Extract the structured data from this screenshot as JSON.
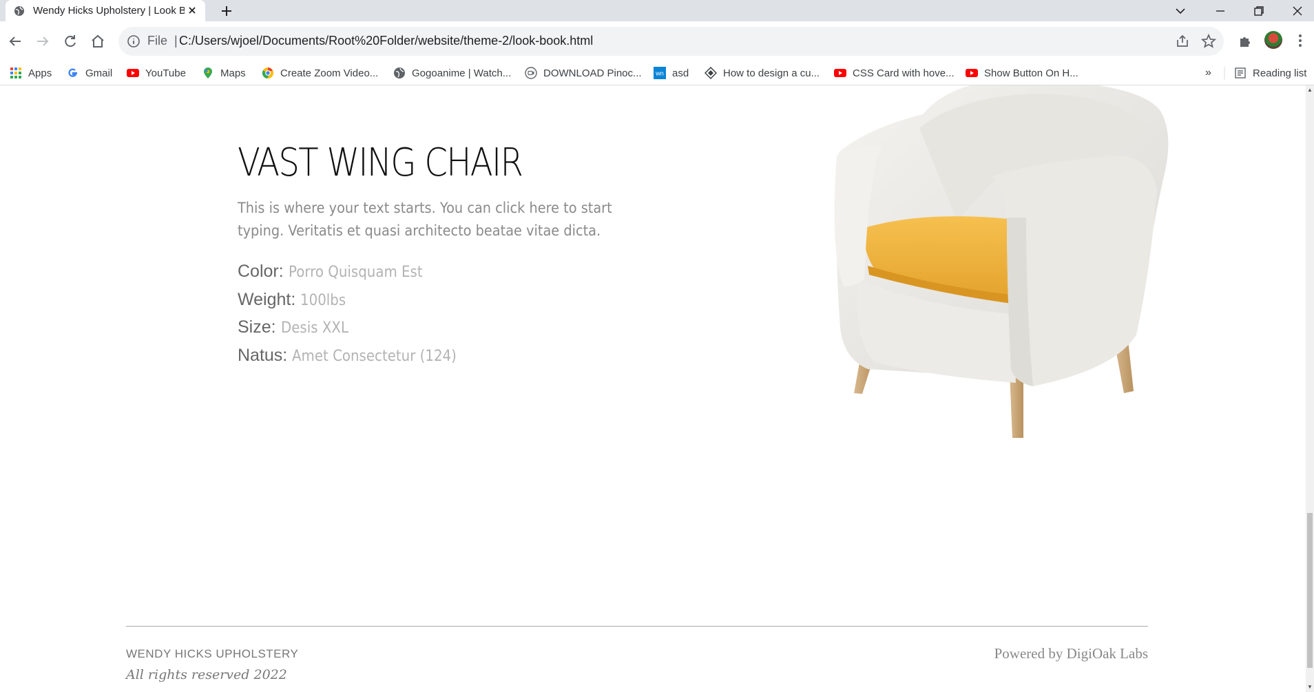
{
  "browser": {
    "tab_title": "Wendy Hicks Upholstery | Look B",
    "address": {
      "scheme": "File",
      "separator": "|",
      "url": "C:/Users/wjoel/Documents/Root%20Folder/website/theme-2/look-book.html"
    },
    "bookmarks": [
      {
        "label": "Apps",
        "icon": "apps-grid-icon"
      },
      {
        "label": "Gmail",
        "icon": "google-icon"
      },
      {
        "label": "YouTube",
        "icon": "youtube-icon"
      },
      {
        "label": "Maps",
        "icon": "maps-pin-icon"
      },
      {
        "label": "Create Zoom Video...",
        "icon": "chrome-icon"
      },
      {
        "label": "Gogoanime | Watch...",
        "icon": "globe-icon"
      },
      {
        "label": "DOWNLOAD Pinoc...",
        "icon": "video-icon"
      },
      {
        "label": "asd",
        "icon": "wn-icon"
      },
      {
        "label": "How to design a cu...",
        "icon": "diamond-icon"
      },
      {
        "label": "CSS Card with hove...",
        "icon": "youtube-icon"
      },
      {
        "label": "Show Button On H...",
        "icon": "youtube-icon"
      }
    ],
    "bookmarks_overflow": "»",
    "reading_list": "Reading list"
  },
  "product": {
    "title": "VAST WING CHAIR",
    "description": "This is where your text starts. You can click here to start typing. Veritatis et quasi architecto beatae vitae dicta.",
    "specs": [
      {
        "label": "Color:",
        "value": "Porro Quisquam Est"
      },
      {
        "label": "Weight:",
        "value": "100lbs"
      },
      {
        "label": "Size:",
        "value": "Desis XXL"
      },
      {
        "label": "Natus:",
        "value": "Amet Consectetur (124)"
      }
    ]
  },
  "footer": {
    "brand": "WENDY HICKS UPHOLSTERY",
    "rights": "All rights reserved 2022",
    "powered": "Powered by DigiOak Labs"
  },
  "colors": {
    "seat": "#f2b43f",
    "chair_body": "#ecebe7",
    "legs": "#c9a57a"
  }
}
